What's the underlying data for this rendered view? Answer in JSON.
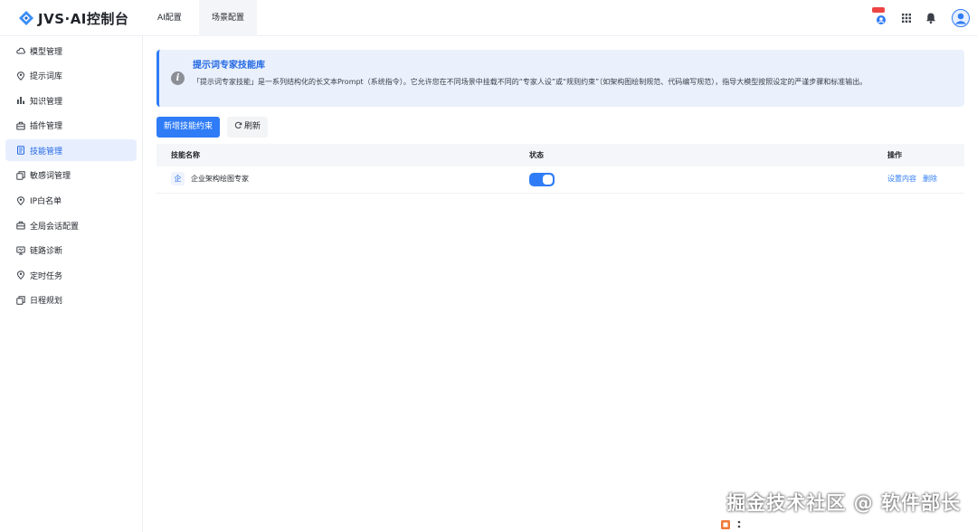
{
  "app": {
    "title": "JVS·AI控制台"
  },
  "header": {
    "tabs": [
      {
        "label": "AI配置"
      },
      {
        "label": "场景配置"
      }
    ]
  },
  "sidebar": {
    "items": [
      {
        "label": "模型管理",
        "icon": "cloud-icon"
      },
      {
        "label": "提示词库",
        "icon": "location-icon"
      },
      {
        "label": "知识管理",
        "icon": "bar-chart-icon"
      },
      {
        "label": "插件管理",
        "icon": "briefcase-icon"
      },
      {
        "label": "技能管理",
        "icon": "document-icon",
        "active": true
      },
      {
        "label": "敏感词管理",
        "icon": "copy-icon"
      },
      {
        "label": "IP白名单",
        "icon": "location-icon"
      },
      {
        "label": "全局会话配置",
        "icon": "briefcase-icon"
      },
      {
        "label": "链路诊断",
        "icon": "monitor-icon"
      },
      {
        "label": "定时任务",
        "icon": "location-icon"
      },
      {
        "label": "日程规划",
        "icon": "copy-icon"
      }
    ]
  },
  "banner": {
    "title": "提示词专家技能库",
    "text": "「提示词专家技能」是一系列结构化的长文本Prompt（系统指令）。它允许您在不同场景中挂载不同的“专家人设”或“规则约束”（如架构图绘制规范、代码编写规范），指导大模型按照设定的严谨步骤和标准输出。"
  },
  "toolbar": {
    "add_label": "新增技能约束",
    "refresh_label": "刷新"
  },
  "table": {
    "columns": [
      "技能名称",
      "状态",
      "操作"
    ],
    "rows": [
      {
        "avatar": "企",
        "name": "企业架构绘图专家",
        "enabled": true,
        "actions": [
          "设置内容",
          "删除"
        ]
      }
    ]
  },
  "watermark": {
    "text": "掘金技术社区 @ 软件部长"
  },
  "colors": {
    "accent": "#2f7cf6",
    "active_bg": "#e7efff",
    "banner_bg": "#eaf1fc"
  }
}
